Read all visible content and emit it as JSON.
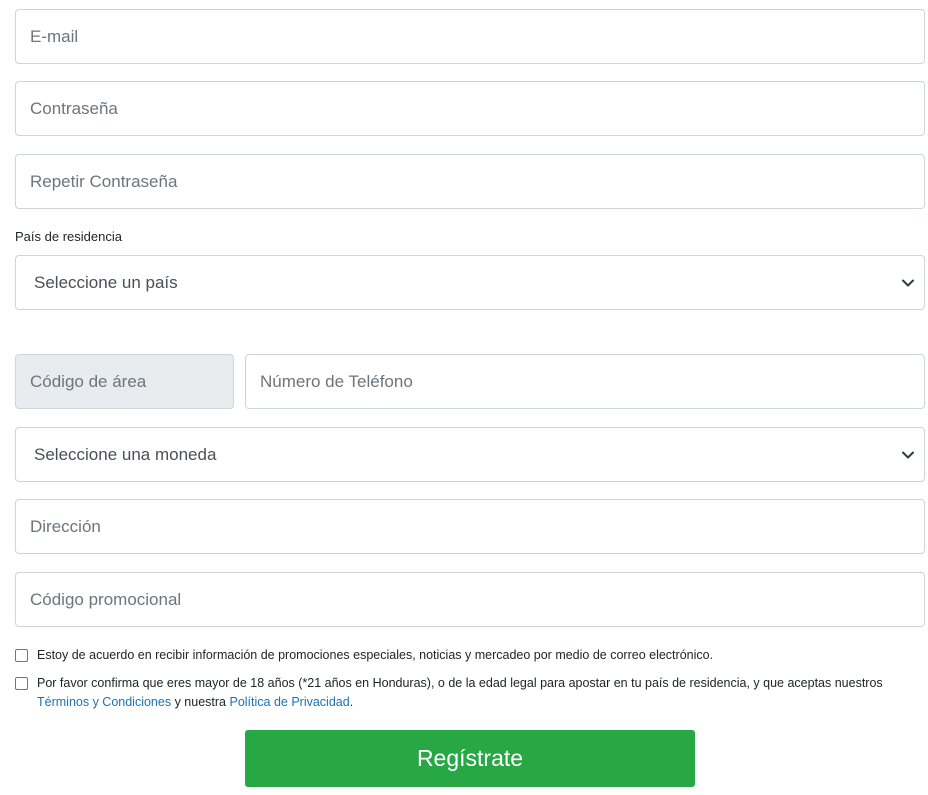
{
  "form": {
    "email_placeholder": "E-mail",
    "password_placeholder": "Contraseña",
    "repeat_password_placeholder": "Repetir Contraseña",
    "country_label": "País de residencia",
    "country_select_value": "Seleccione un país",
    "area_code_placeholder": "Código de área",
    "phone_placeholder": "Número de Teléfono",
    "currency_select_value": "Seleccione una moneda",
    "address_placeholder": "Dirección",
    "promo_code_placeholder": "Código promocional",
    "consent_marketing": "Estoy de acuerdo en recibir información de promociones especiales, noticias y mercadeo por medio de correo electrónico.",
    "consent_age_prefix": "Por favor confirma que eres mayor de 18 años (*21 años en Honduras), o de la edad legal para apostar en tu país de residencia, y que aceptas nuestros",
    "terms_link": "Términos y Condiciones",
    "consent_age_middle": "y nuestra",
    "privacy_link": "Política de Privacidad",
    "consent_age_suffix": ".",
    "submit_label": "Regístrate"
  },
  "icons": {
    "select_arrow": "chevron-down-icon"
  },
  "colors": {
    "primary_button": "#28a745",
    "link": "#1a73b7",
    "border": "#ced4da",
    "disabled_bg": "#e9ecef"
  }
}
